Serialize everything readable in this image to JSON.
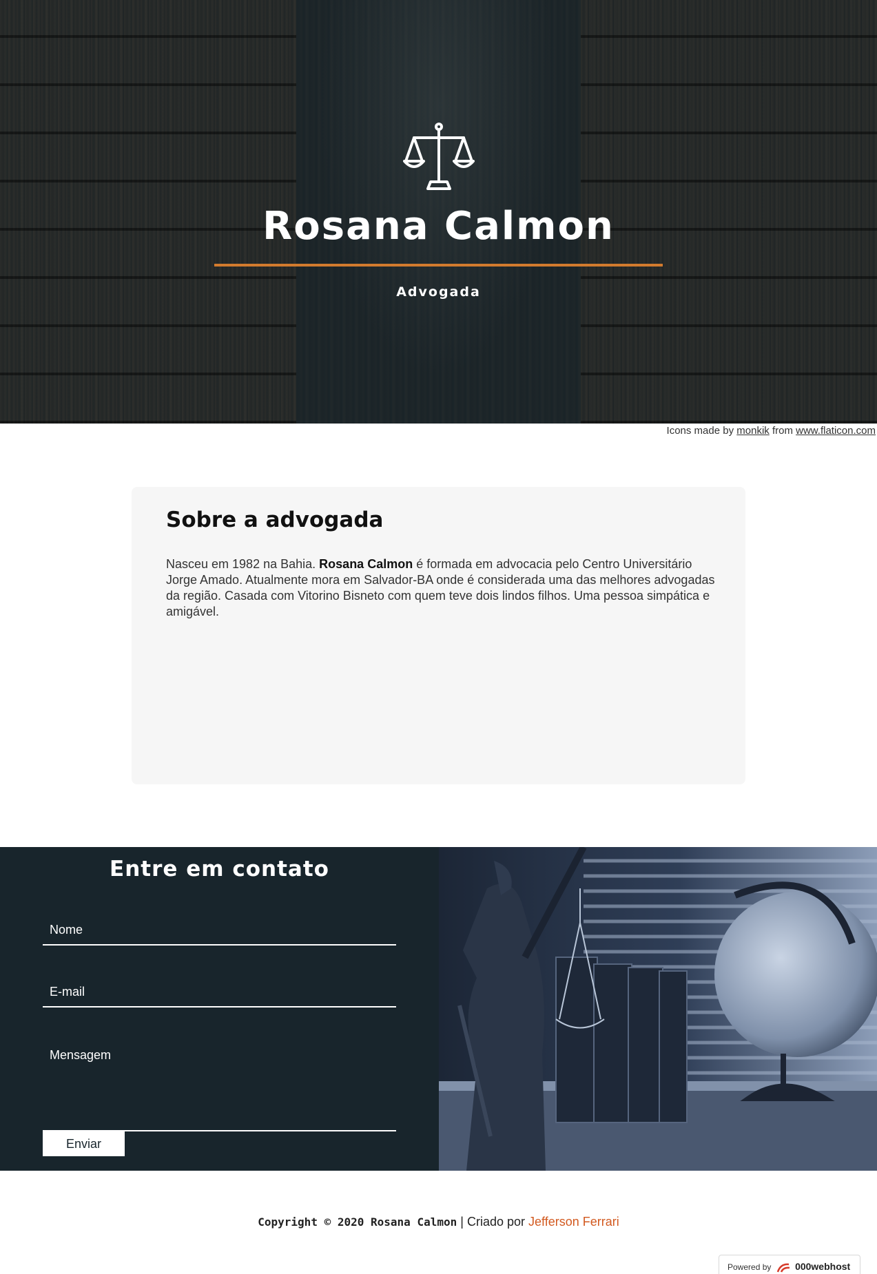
{
  "hero": {
    "title": "Rosana Calmon",
    "subtitle": "Advogada",
    "icon": "scales-of-justice-icon",
    "accent_color": "#d27b2e"
  },
  "credit": {
    "prefix": "Icons made by",
    "author": "monkik",
    "middle": "from",
    "site": "www.flaticon.com"
  },
  "about": {
    "title": "Sobre a advogada",
    "text_1": "Nasceu em 1982 na Bahia.",
    "name_bold": "Rosana Calmon",
    "text_2": "é formada em advocacia pelo Centro Universitário Jorge Amado. Atualmente mora em Salvador-BA onde é considerada uma das melhores advogadas da região. Casada com Vitorino Bisneto com quem teve dois lindos filhos. Uma pessoa simpática e amigável."
  },
  "contact": {
    "title": "Entre em contato",
    "name_placeholder": "Nome",
    "email_placeholder": "E-mail",
    "message_placeholder": "Mensagem",
    "send_label": "Enviar",
    "bg_color": "#18252c"
  },
  "footer": {
    "copyright": "Copyright © 2020 Rosana Calmon",
    "separator": "|",
    "created_by": "Criado por",
    "author": "Jefferson Ferrari",
    "author_color": "#d2591f"
  },
  "powered": {
    "label": "Powered by",
    "brand": "000webhost"
  }
}
